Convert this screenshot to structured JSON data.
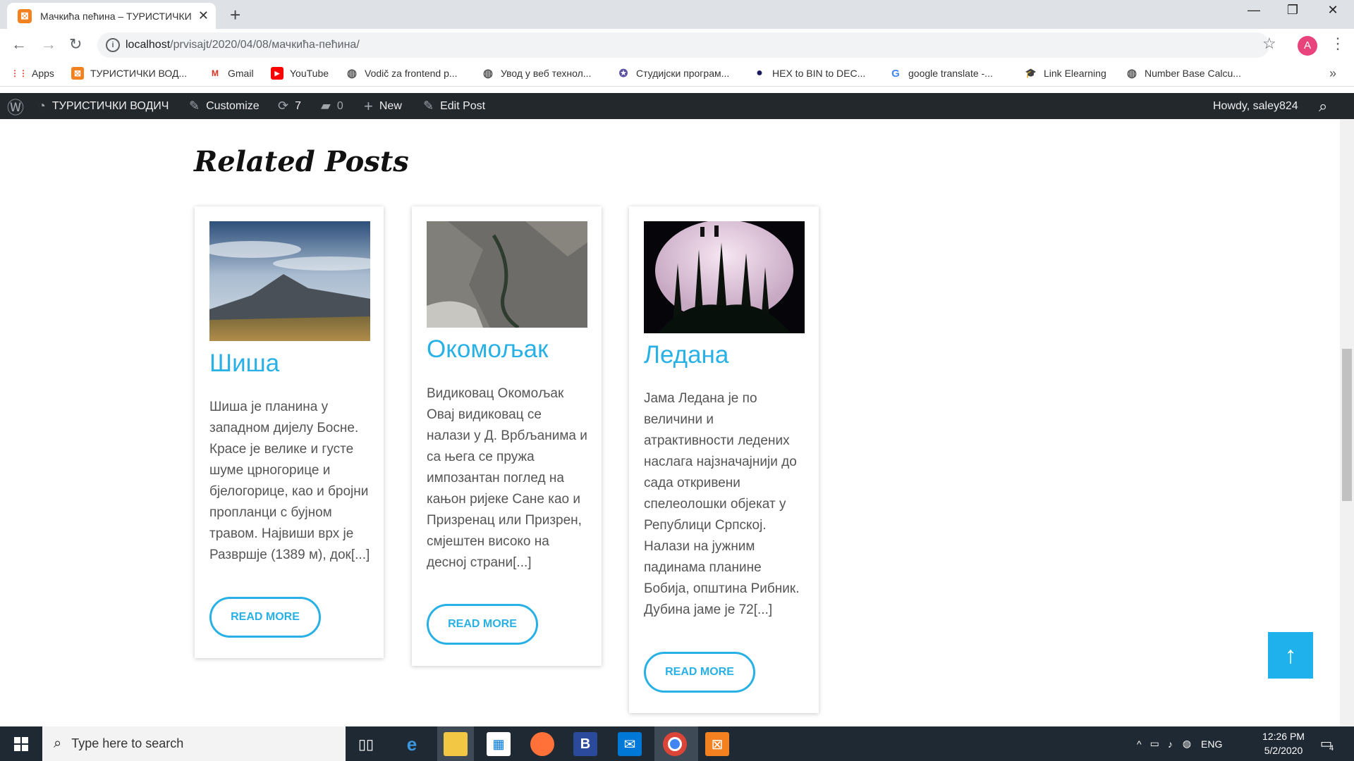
{
  "browser": {
    "tab_title": "Мачкића пећина – ТУРИСТИЧКИ",
    "tab_favicon": "⊠",
    "close_glyph": "✕",
    "new_tab_glyph": "+",
    "window_controls": {
      "minimize": "—",
      "maximize": "❐",
      "close": "✕"
    },
    "nav": {
      "back": "←",
      "forward": "→",
      "reload": "↻"
    },
    "url_host": "localhost",
    "url_path": "/prvisajt/2020/04/08/мачкића-пећина/",
    "star_glyph": "☆",
    "profile_initial": "A",
    "menu_glyph": "⋮"
  },
  "bookmarks": [
    {
      "label": "Apps",
      "icon": "apps-grid-icon",
      "glyph": "⋮⋮",
      "color": "#ea4335"
    },
    {
      "label": "ТУРИСТИЧКИ ВОД...",
      "icon": "xampp-icon",
      "glyph": "⊠",
      "color": "#f38120"
    },
    {
      "label": "Gmail",
      "icon": "gmail-icon",
      "glyph": "M",
      "color": "#d93025"
    },
    {
      "label": "YouTube",
      "icon": "youtube-icon",
      "glyph": "▶",
      "color": "#ff0000"
    },
    {
      "label": "Vodič za frontend p...",
      "icon": "globe-icon",
      "glyph": "◍",
      "color": "#555555"
    },
    {
      "label": "Увод у веб технол...",
      "icon": "globe-icon",
      "glyph": "◍",
      "color": "#555555"
    },
    {
      "label": "Студијски програм...",
      "icon": "university-icon",
      "glyph": "✪",
      "color": "#5a4fa0"
    },
    {
      "label": "HEX to BIN to DEC...",
      "icon": "hex-icon",
      "glyph": "●",
      "color": "#1a1a5e"
    },
    {
      "label": "google translate -...",
      "icon": "google-icon",
      "glyph": "G",
      "color": "#4285f4"
    },
    {
      "label": "Link Elearning",
      "icon": "elearning-icon",
      "glyph": "🎓",
      "color": "#8b4513"
    },
    {
      "label": "Number Base Calcu...",
      "icon": "globe-icon",
      "glyph": "◍",
      "color": "#555555"
    }
  ],
  "bookmarks_more": "»",
  "adminbar": {
    "wp_logo": "Ⓦ",
    "site_name": "ТУРИСТИЧКИ ВОДИЧ",
    "site_icon": "◔",
    "customize": "Customize",
    "customize_icon": "✎",
    "updates_count": "7",
    "updates_icon": "⟳",
    "comments_count": "0",
    "comments_icon": "▰",
    "new_label": "New",
    "new_icon": "+",
    "edit_label": "Edit Post",
    "edit_icon": "✎",
    "howdy": "Howdy, saley824",
    "search_icon": "⌕"
  },
  "page": {
    "heading": "Related Posts",
    "read_more": "READ MORE",
    "back_to_top": "↑",
    "posts": [
      {
        "title": "Шиша",
        "excerpt": "Шиша је планина у западном дијелу Босне. Красе је велике и густе шуме црногорице и бјелогорице, као и бројни пропланци с бујном травом. Највиши врх је Развршје (1389 м), док[...]"
      },
      {
        "title": "Окомољак",
        "excerpt": "Видиковац Окомољак Овај видиковац се налази у Д. Врбљанима и са њега се пружа импозантан поглед на кањон ријеке Сане као и Призренац или Призрен, смјештен високо на десној страни[...]"
      },
      {
        "title": "Ледана",
        "excerpt": "Јама Ледана је по величини и атрактивности ледених наслага најзначајнији до сада откривени спелеолошки објекат у Републици Српској. Налази на јужним падинама планине Бобија, општина Рибник. Дубина јаме је 72[...]"
      }
    ]
  },
  "taskbar": {
    "search_placeholder": "Type here to search",
    "search_icon": "⌕",
    "time": "12:26 PM",
    "date": "5/2/2020",
    "lang": "ENG",
    "notifications": "4",
    "tray_caret": "^"
  },
  "colors": {
    "accent": "#29b1e6",
    "adminbar": "#23282d",
    "taskbar": "#1f2933"
  }
}
